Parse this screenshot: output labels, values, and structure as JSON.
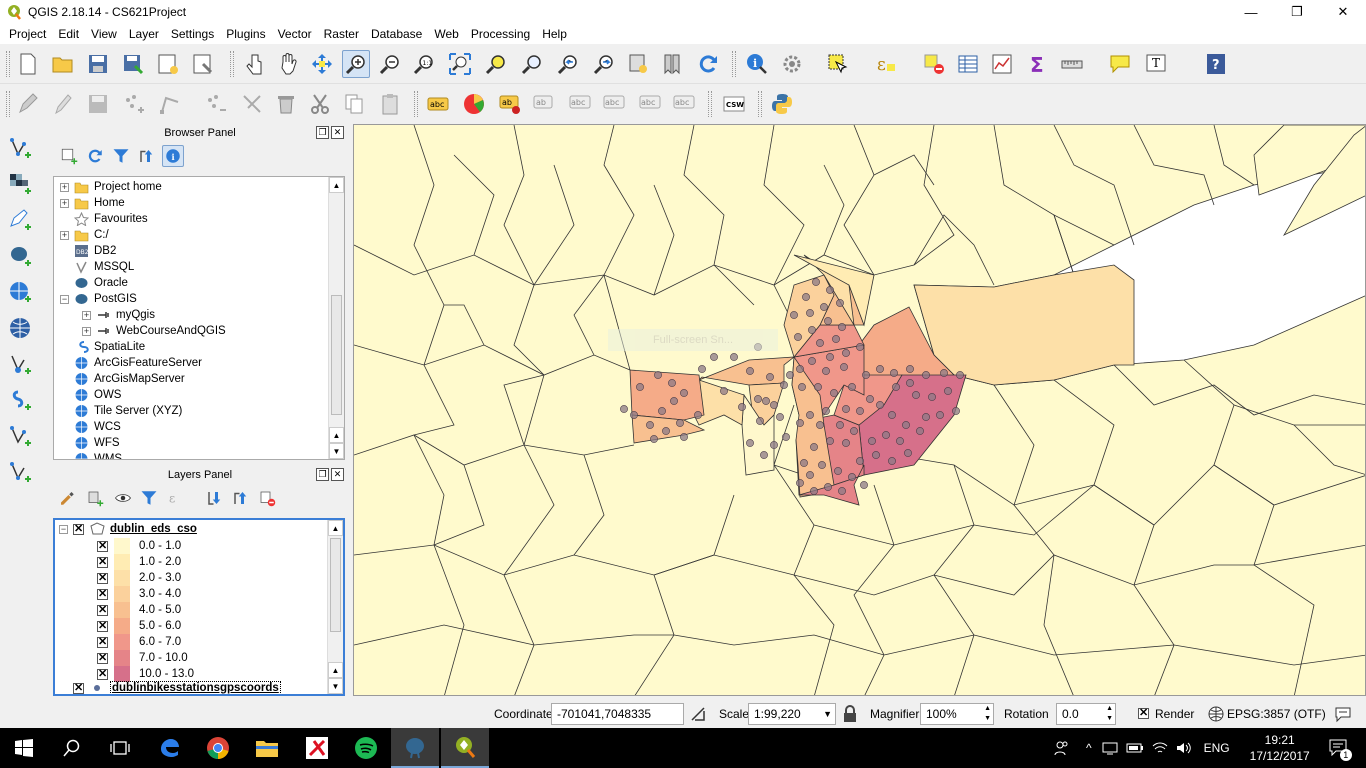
{
  "window": {
    "title": "QGIS 2.18.14 - CS621Project",
    "min": "—",
    "max": "❐",
    "close": "✕"
  },
  "menu": [
    "Project",
    "Edit",
    "View",
    "Layer",
    "Settings",
    "Plugins",
    "Vector",
    "Raster",
    "Database",
    "Web",
    "Processing",
    "Help"
  ],
  "browser_panel": {
    "title": "Browser Panel",
    "items": [
      {
        "label": "Project home",
        "icon": "folder-icon",
        "expandable": true,
        "indent": 0
      },
      {
        "label": "Home",
        "icon": "folder-icon",
        "expandable": true,
        "indent": 0
      },
      {
        "label": "Favourites",
        "icon": "star-icon",
        "expandable": false,
        "indent": 0
      },
      {
        "label": "C:/",
        "icon": "folder-icon",
        "expandable": true,
        "indent": 0
      },
      {
        "label": "DB2",
        "icon": "db2-icon",
        "expandable": false,
        "indent": 0
      },
      {
        "label": "MSSQL",
        "icon": "mssql-icon",
        "expandable": false,
        "indent": 0
      },
      {
        "label": "Oracle",
        "icon": "oracle-icon",
        "expandable": false,
        "indent": 0
      },
      {
        "label": "PostGIS",
        "icon": "postgis-icon",
        "expandable": true,
        "expanded": true,
        "indent": 0
      },
      {
        "label": "myQgis",
        "icon": "connection-icon",
        "expandable": true,
        "indent": 1
      },
      {
        "label": "WebCourseAndQGIS",
        "icon": "connection-icon",
        "expandable": true,
        "indent": 1
      },
      {
        "label": "SpatiaLite",
        "icon": "spatialite-icon",
        "expandable": false,
        "indent": 0
      },
      {
        "label": "ArcGisFeatureServer",
        "icon": "globe-icon",
        "expandable": false,
        "indent": 0
      },
      {
        "label": "ArcGisMapServer",
        "icon": "globe-icon",
        "expandable": false,
        "indent": 0
      },
      {
        "label": "OWS",
        "icon": "globe-icon",
        "expandable": false,
        "indent": 0
      },
      {
        "label": "Tile Server (XYZ)",
        "icon": "globe-icon",
        "expandable": false,
        "indent": 0
      },
      {
        "label": "WCS",
        "icon": "globe-icon",
        "expandable": false,
        "indent": 0
      },
      {
        "label": "WFS",
        "icon": "globe-icon",
        "expandable": false,
        "indent": 0
      },
      {
        "label": "WMS",
        "icon": "globe-icon",
        "expandable": false,
        "indent": 0
      }
    ]
  },
  "layers_panel": {
    "title": "Layers Panel",
    "layer1": "dublin_eds_cso",
    "legend": [
      {
        "label": "0.0 - 1.0",
        "color": "#fff8cc"
      },
      {
        "label": "1.0 - 2.0",
        "color": "#ffecb3"
      },
      {
        "label": "2.0 - 3.0",
        "color": "#fde0a8"
      },
      {
        "label": "3.0 - 4.0",
        "color": "#fbd19c"
      },
      {
        "label": "4.0 - 5.0",
        "color": "#f8c090"
      },
      {
        "label": "5.0 - 6.0",
        "color": "#f5ab88"
      },
      {
        "label": "6.0 - 7.0",
        "color": "#f0978a"
      },
      {
        "label": "7.0 - 10.0",
        "color": "#e58488"
      },
      {
        "label": "10.0 - 13.0",
        "color": "#d6708a"
      }
    ],
    "layer2": "dublinbikesstationsgpscoords"
  },
  "map_overlay": "Full-screen Sn...",
  "status": {
    "coordinate_label": "Coordinate",
    "coordinate": "-701041,7048335",
    "scale_label": "Scale",
    "scale": "1:99,220",
    "magnifier_label": "Magnifier",
    "magnifier": "100%",
    "rotation_label": "Rotation",
    "rotation": "0.0",
    "render_label": "Render",
    "crs": "EPSG:3857 (OTF)"
  },
  "taskbar": {
    "lang": "ENG",
    "time": "19:21",
    "date": "17/12/2017",
    "notif": "1"
  }
}
